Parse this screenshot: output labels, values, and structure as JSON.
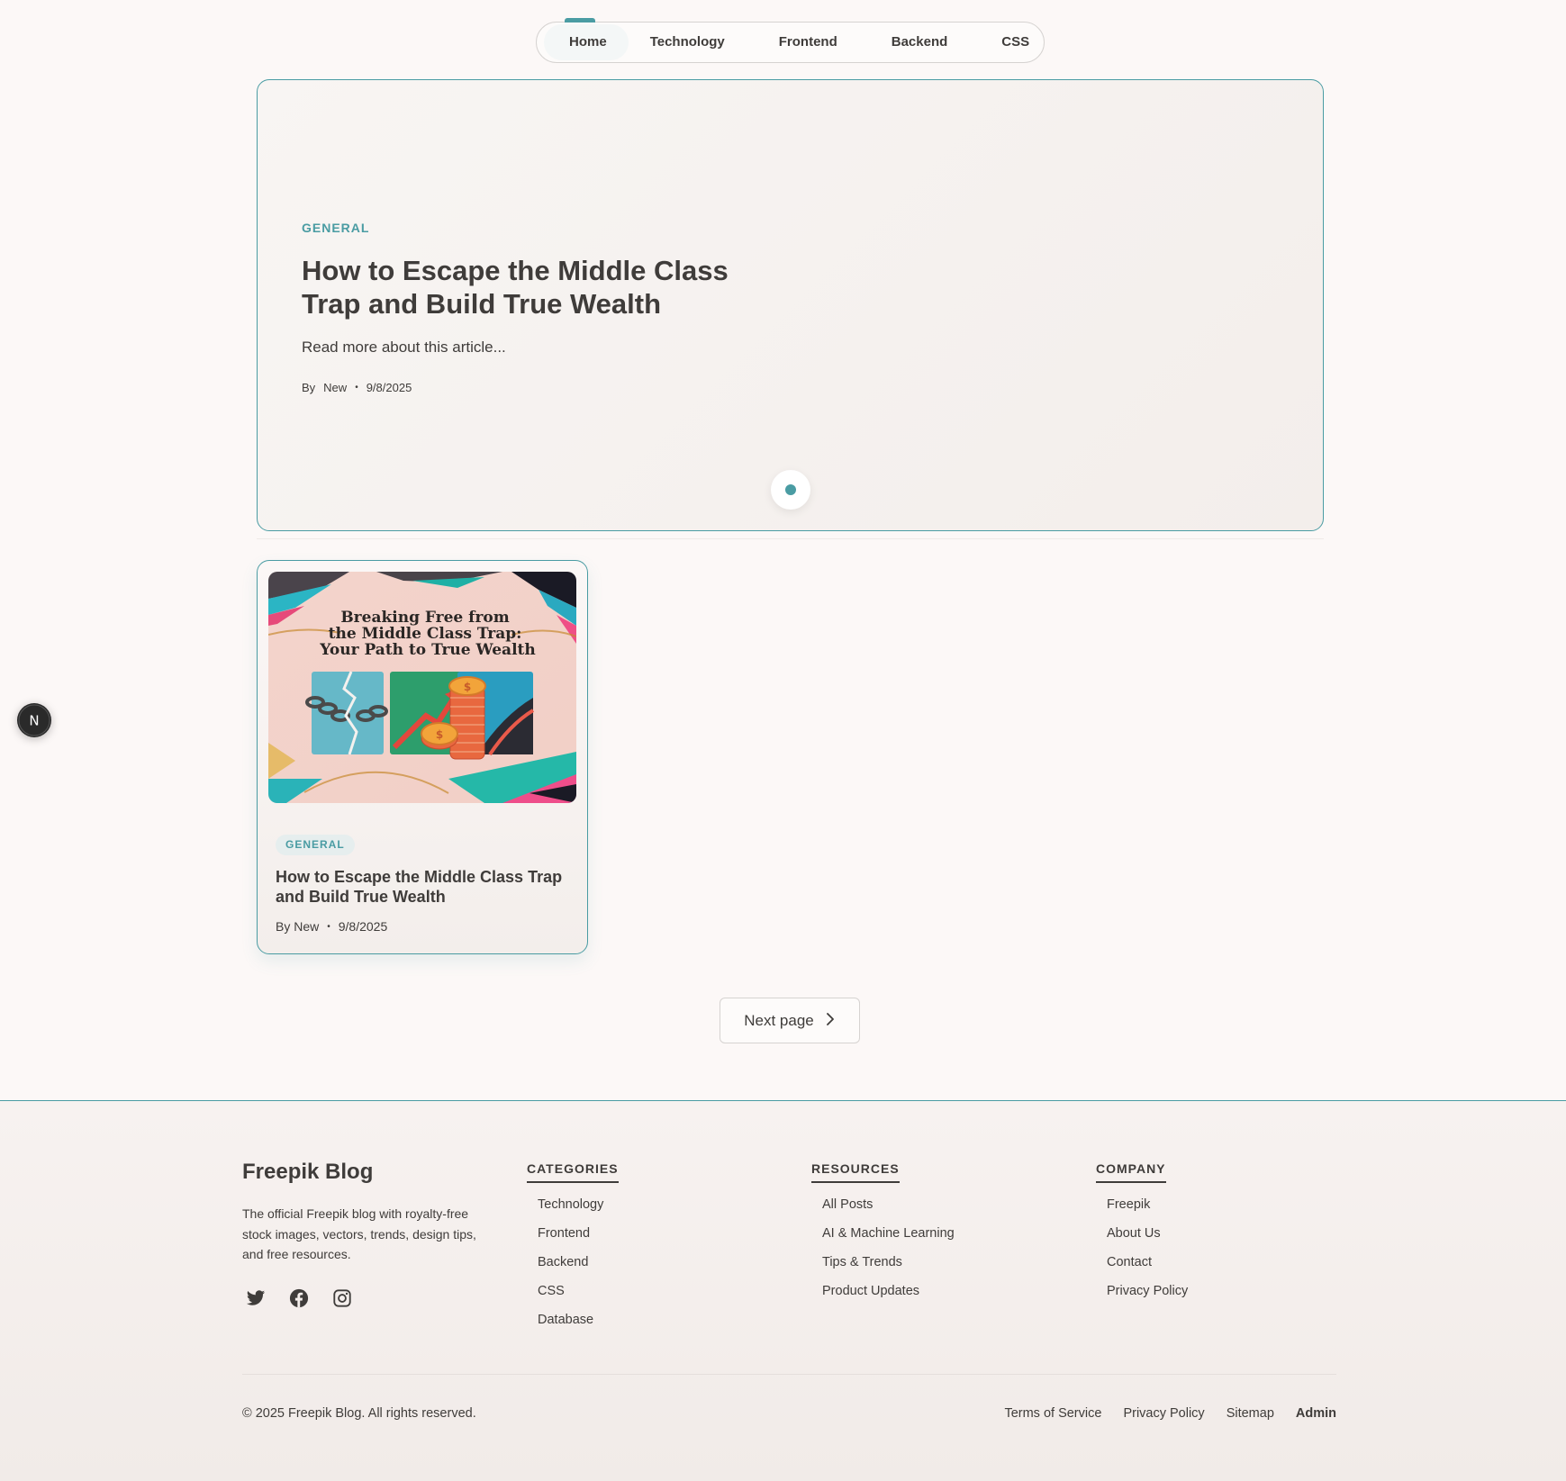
{
  "nav": {
    "items": [
      {
        "label": "Home",
        "active": true
      },
      {
        "label": "Technology"
      },
      {
        "label": "Frontend"
      },
      {
        "label": "Backend"
      },
      {
        "label": "CSS"
      }
    ]
  },
  "hero": {
    "category": "GENERAL",
    "title": "How to Escape the Middle Class Trap and Build True Wealth",
    "excerpt": "Read more about this article...",
    "by": "By",
    "author": "New",
    "separator": "•",
    "date": "9/8/2025"
  },
  "card": {
    "image_text": [
      "Breaking Free from",
      "the Middle Class Trap:",
      "Your Path to True Wealth"
    ],
    "category": "GENERAL",
    "title": "How to Escape the Middle Class Trap and Build True Wealth",
    "author": "By New",
    "separator": "•",
    "date": "9/8/2025"
  },
  "pagination": {
    "next_label": "Next page",
    "next_icon": "chevron-right-icon"
  },
  "floating_badge": {
    "letter": "N"
  },
  "footer": {
    "brand": "Freepik Blog",
    "description": "The official Freepik blog with royalty-free stock images, vectors, trends, design tips, and free resources.",
    "social": [
      "twitter-icon",
      "facebook-icon",
      "instagram-icon"
    ],
    "columns": [
      {
        "heading": "CATEGORIES",
        "links": [
          "Technology",
          "Frontend",
          "Backend",
          "CSS",
          "Database"
        ]
      },
      {
        "heading": "RESOURCES",
        "links": [
          "All Posts",
          "AI & Machine Learning",
          "Tips & Trends",
          "Product Updates"
        ]
      },
      {
        "heading": "COMPANY",
        "links": [
          "Freepik",
          "About Us",
          "Contact",
          "Privacy Policy"
        ]
      }
    ],
    "copyright": "© 2025 Freepik Blog. All rights reserved.",
    "bottom_links": [
      "Terms of Service",
      "Privacy Policy",
      "Sitemap",
      "Admin"
    ]
  },
  "colors": {
    "accent": "#4a9ca3",
    "text": "#3f3c3a",
    "background": "#fcf8f7"
  }
}
